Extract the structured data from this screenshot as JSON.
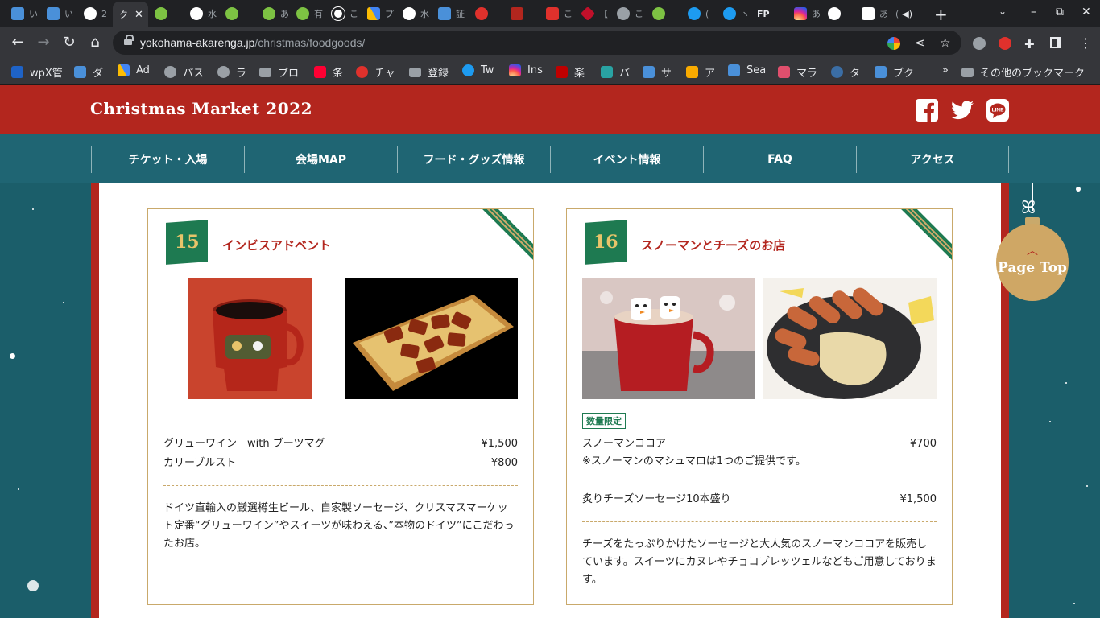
{
  "browser": {
    "tabs": [
      {
        "icon": "bing-icon",
        "text": "い",
        "color": "#4a90d9"
      },
      {
        "icon": "bing-icon",
        "text": "い",
        "color": "#4a90d9"
      },
      {
        "icon": "google-icon",
        "text": "2",
        "color": "#ffffff"
      },
      {
        "icon": "site-icon",
        "text": "ク",
        "color": "#ffffff",
        "active": true
      },
      {
        "icon": "green-circle-icon",
        "text": "",
        "color": "#7dc243"
      },
      {
        "icon": "google-icon",
        "text": "水",
        "color": "#ffffff"
      },
      {
        "icon": "green-circle-icon",
        "text": "",
        "color": "#7dc243"
      },
      {
        "icon": "green-circle-icon",
        "text": "あ",
        "color": "#7dc243"
      },
      {
        "icon": "green-circle-icon",
        "text": "有",
        "color": "#7dc243"
      },
      {
        "icon": "clock-icon",
        "text": "こ",
        "color": "#ffffff"
      },
      {
        "icon": "ads-icon",
        "text": "プ",
        "color": "#fbbc04"
      },
      {
        "icon": "google-icon",
        "text": "水",
        "color": "#ffffff"
      },
      {
        "icon": "bing-icon",
        "text": "証",
        "color": "#4a90d9"
      },
      {
        "icon": "red-icon",
        "text": "",
        "color": "#e0312c"
      },
      {
        "icon": "red-square-icon",
        "text": "",
        "color": "#b3261e"
      },
      {
        "icon": "mail-icon",
        "text": "こ",
        "color": "#e0312c"
      },
      {
        "icon": "red-diamond-icon",
        "text": "【",
        "color": "#c0102a"
      },
      {
        "icon": "globe-icon",
        "text": "こ",
        "color": "#9aa0a6"
      },
      {
        "icon": "green-circle-icon",
        "text": "",
        "color": "#7dc243"
      },
      {
        "icon": "twitter-icon",
        "text": "(",
        "color": "#1d9bf0"
      },
      {
        "icon": "twitter-icon",
        "text": "ヽ",
        "color": "#1d9bf0"
      },
      {
        "icon": "fp-icon",
        "text": "FP",
        "color": "#202124"
      },
      {
        "icon": "instagram-icon",
        "text": "あ",
        "color": "#d6249f"
      },
      {
        "icon": "google-icon",
        "text": "",
        "color": "#ffffff"
      },
      {
        "icon": "doc-icon",
        "text": "あ",
        "color": "#ffffff"
      },
      {
        "icon": "audio-icon",
        "text": "(",
        "color": "#e8eaed"
      }
    ],
    "new_tab": "+",
    "tab_search": "⌄",
    "window_controls": {
      "minimize": "–",
      "maximize": "⧉",
      "close": "✕"
    },
    "nav": {
      "back": "←",
      "forward": "→",
      "reload": "↻",
      "home": "⌂"
    },
    "url_host": "yokohama-akarenga.jp",
    "url_path": "/christmas/foodgoods/",
    "bookmarks": [
      {
        "icon": "x-icon",
        "label": "wpX管",
        "color": "#1e63c7"
      },
      {
        "icon": "bing-icon",
        "label": "ダ",
        "color": "#4a90d9"
      },
      {
        "icon": "ads-icon",
        "label": "Ad",
        "color": "#fbbc04"
      },
      {
        "icon": "gear-icon",
        "label": "パス",
        "color": "#9aa0a6"
      },
      {
        "icon": "ninja-icon",
        "label": "ラ",
        "color": "#9aa0a6"
      },
      {
        "icon": "folder-icon",
        "label": "ブロ",
        "color": "#9aa0a6"
      },
      {
        "icon": "yahoo-icon",
        "label": "条",
        "color": "#ff0033"
      },
      {
        "icon": "chat-icon",
        "label": "チャ",
        "color": "#e0312c"
      },
      {
        "icon": "folder-icon",
        "label": "登録",
        "color": "#9aa0a6"
      },
      {
        "icon": "twitter-icon",
        "label": "Tw",
        "color": "#1d9bf0"
      },
      {
        "icon": "instagram-icon",
        "label": "Ins",
        "color": "#d6249f"
      },
      {
        "icon": "rakuten-icon",
        "label": "楽",
        "color": "#bf0000"
      },
      {
        "icon": "vb-icon",
        "label": "バ",
        "color": "#29a3a3"
      },
      {
        "icon": "shop-icon",
        "label": "サ",
        "color": "#4a90d9"
      },
      {
        "icon": "analytics-icon",
        "label": "ア",
        "color": "#f9ab00"
      },
      {
        "icon": "shop-icon",
        "label": "Sea",
        "color": "#4a90d9"
      },
      {
        "icon": "pattern-icon",
        "label": "マラ",
        "color": "#e04f6d"
      },
      {
        "icon": "moon-icon",
        "label": "タ",
        "color": "#3b6ea5"
      },
      {
        "icon": "book-icon",
        "label": "ブク",
        "color": "#4a90d9"
      }
    ],
    "more_bookmarks": "»",
    "other_bookmarks": "その他のブックマーク"
  },
  "site": {
    "logo": "Christmas Market 2022",
    "sns": [
      "facebook-icon",
      "twitter-icon",
      "line-icon"
    ],
    "line_label": "LINE",
    "nav": [
      "チケット・入場",
      "会場MAP",
      "フード・グッズ情報",
      "イベント情報",
      "FAQ",
      "アクセス"
    ],
    "page_top": "Page Top",
    "colors": {
      "brand_red": "#b3261e",
      "nav_teal": "#1f6573",
      "accent_green": "#1e7a51",
      "gold": "#c9a96b"
    }
  },
  "cards": [
    {
      "number": "15",
      "name": "インビスアドベント",
      "tag": "",
      "menu": [
        {
          "item": "グリューワイン　with ブーツマグ",
          "price": "¥1,500"
        },
        {
          "item": "カリーブルスト",
          "price": "¥800"
        }
      ],
      "note": "",
      "description": "ドイツ直輸入の厳選樽生ビール、自家製ソーセージ、クリスマスマーケット定番“グリューワイン”やスイーツが味わえる、”本物のドイツ”にこだわったお店。"
    },
    {
      "number": "16",
      "name": "スノーマンとチーズのお店",
      "tag": "数量限定",
      "menu": [
        {
          "item": "スノーマンココア",
          "price": "¥700"
        },
        {
          "item": "炙りチーズソーセージ10本盛り",
          "price": "¥1,500"
        }
      ],
      "note": "※スノーマンのマシュマロは1つのご提供です。",
      "description": "チーズをたっぷりかけたソーセージと大人気のスノーマンココアを販売しています。スイーツにカヌレやチョコプレッツェルなどもご用意しております。"
    }
  ]
}
